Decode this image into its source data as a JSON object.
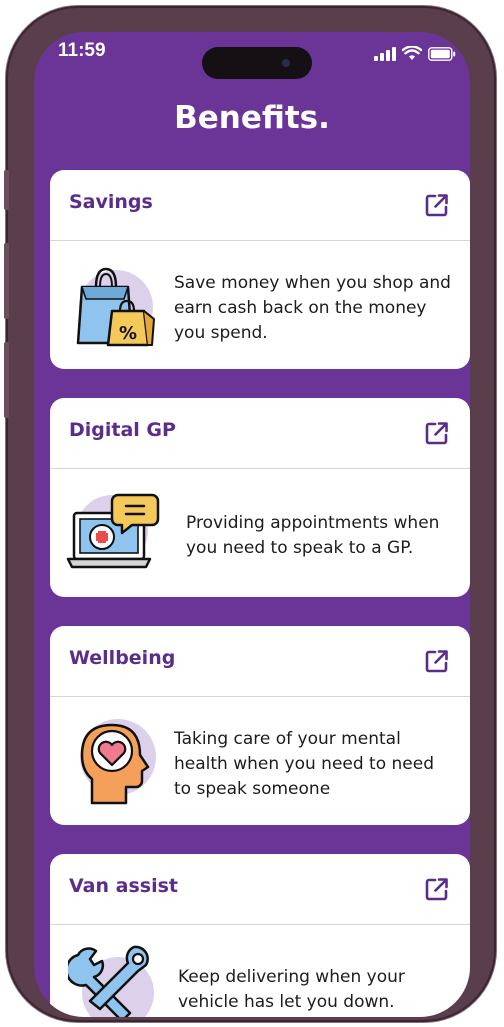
{
  "status_bar": {
    "time": "11:59"
  },
  "page": {
    "title": "Benefits."
  },
  "colors": {
    "background": "#6a3596",
    "card_title": "#5b2d8a",
    "card": "#ffffff"
  },
  "cards": [
    {
      "title": "Savings",
      "description": "Save money when you shop and earn cash back on the money you spend.",
      "illustration": "shopping-bags-icon",
      "action_icon": "external-link-icon"
    },
    {
      "title": "Digital GP",
      "description": "Providing appointments when you need to speak to a GP.",
      "illustration": "laptop-medical-chat-icon",
      "action_icon": "external-link-icon"
    },
    {
      "title": "Wellbeing",
      "description": "Taking care of your mental health when you need to need to speak someone",
      "illustration": "head-heart-icon",
      "action_icon": "external-link-icon"
    },
    {
      "title": "Van assist",
      "description": "Keep delivering when your vehicle has let you down.",
      "illustration": "wrench-tools-icon",
      "action_icon": "external-link-icon"
    }
  ]
}
